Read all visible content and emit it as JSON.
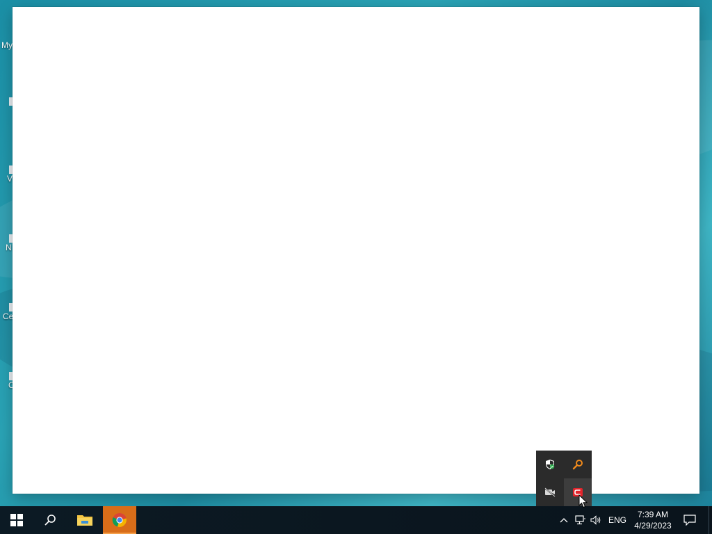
{
  "desktop": {
    "icons": [
      {
        "label": "My"
      },
      {
        "label": ""
      },
      {
        "label": "V"
      },
      {
        "label": "N"
      },
      {
        "label": "Ce"
      },
      {
        "label": "C"
      }
    ]
  },
  "tray_flyout": {
    "items": [
      "windows-security-icon",
      "search-tool-icon",
      "camera-off-icon",
      "red-app-icon"
    ]
  },
  "taskbar": {
    "buttons": [
      "start-button",
      "search-button",
      "file-explorer-button",
      "browser-button"
    ],
    "language": "ENG",
    "time": "7:39 AM",
    "date": "4/29/2023"
  }
}
